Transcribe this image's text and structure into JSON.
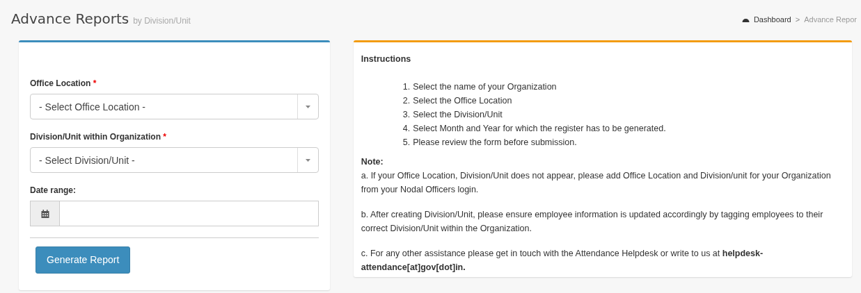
{
  "header": {
    "title": "Advance Reports",
    "subtitle": "by Division/Unit"
  },
  "breadcrumb": [
    {
      "label": "Dashboard",
      "kind": "home"
    },
    {
      "label": "Advance Repor",
      "kind": "current",
      "separator": ">"
    }
  ],
  "form": {
    "fields": [
      {
        "kind": "select",
        "label": "Office Location",
        "required_mark": "*",
        "placeholder": "- Select Office Location -"
      },
      {
        "kind": "select",
        "label": "Division/Unit within Organization",
        "required_mark": "*",
        "placeholder": "- Select Division/Unit -"
      },
      {
        "kind": "date",
        "label": "Date range:"
      }
    ],
    "submit": "Generate Report"
  },
  "instructions": {
    "title": "Instructions",
    "steps": [
      {
        "number": "1.",
        "text": "Select the name of your Organization"
      },
      {
        "number": "2.",
        "text": "Select the Office Location"
      },
      {
        "number": "3.",
        "text": "Select the Division/Unit"
      },
      {
        "number": "4.",
        "text": "Select Month and Year for which the register has to be generated."
      },
      {
        "number": "5.",
        "text": "Please review the form before submission."
      }
    ],
    "note_title": "Note:",
    "notes": [
      "a. If your Office Location, Division/Unit does not appear, please add Office Location and Division/unit for your Organization from your Nodal Officers login.",
      "b. After creating Division/Unit, please ensure employee information is updated accordingly by tagging employees to their correct Division/Unit within the Organization.",
      "c. For any other assistance please get in touch with the Attendance Helpdesk or write to us at **helpdesk-attendance[at]gov[dot]in.**"
    ]
  }
}
